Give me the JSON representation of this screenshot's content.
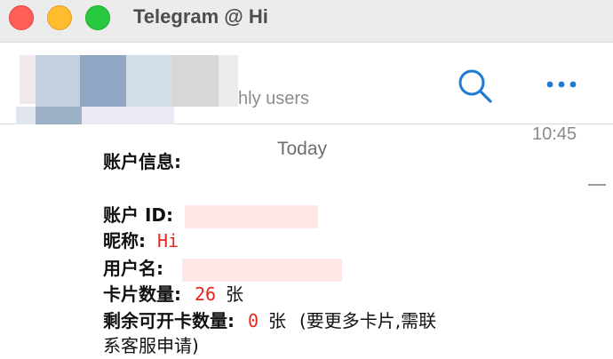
{
  "window": {
    "title": "Telegram @ Hi"
  },
  "header": {
    "subtitle": "hly users",
    "search_icon": "search-icon",
    "more_icon": "more-icon",
    "accent_color": "#1f7bd1"
  },
  "chat": {
    "date_separator": "Today",
    "time": "10:45",
    "message": {
      "heading": "账户信息:",
      "account_id_label": "账户 ID:",
      "nickname_label": "昵称:",
      "nickname_value": "Hi",
      "username_label": "用户名:",
      "cards_label": "卡片数量:",
      "cards_value": "26",
      "cards_unit": "张",
      "remaining_label": "剩余可开卡数量:",
      "remaining_value": "0",
      "remaining_unit": "张",
      "remaining_note_line1": "(要更多卡片,需联",
      "remaining_note_line2": "系客服申请)"
    }
  }
}
